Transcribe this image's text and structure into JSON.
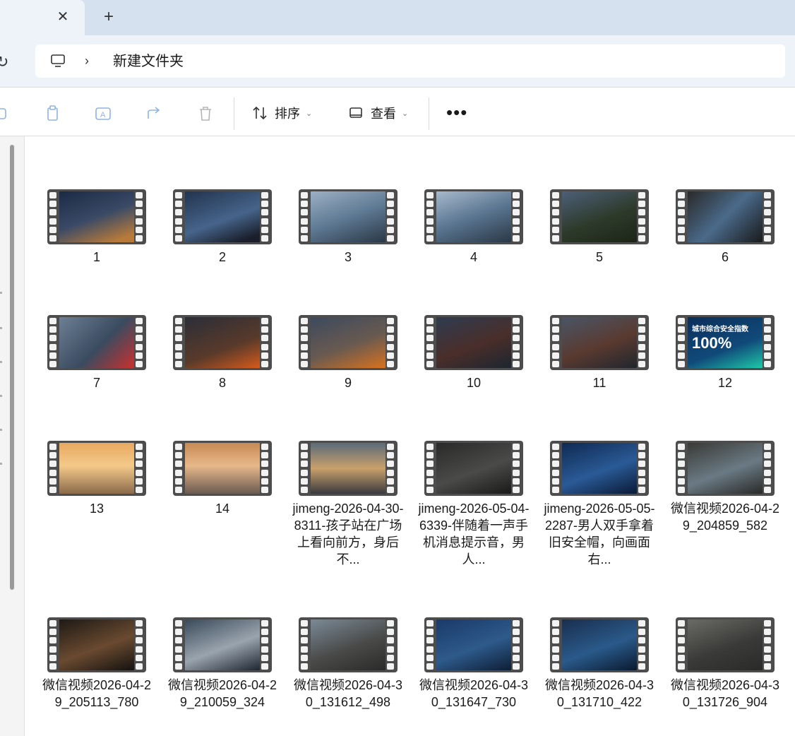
{
  "tabs": {
    "close_icon": "close-icon",
    "new_tab": "+"
  },
  "address": {
    "breadcrumb": "新建文件夹"
  },
  "toolbar": {
    "sort_label": "排序",
    "view_label": "查看",
    "more_label": "•••"
  },
  "colors": {
    "tab_strip": "#d6e1f0",
    "address_bar": "#eef3fa"
  },
  "files": [
    {
      "name": "1",
      "bg": "linear-gradient(160deg,#1b2a44,#3a4a66 50%,#b87a3a 90%)"
    },
    {
      "name": "2",
      "bg": "linear-gradient(160deg,#22344f,#46648a 55%,#1a1f2b 90%)"
    },
    {
      "name": "3",
      "bg": "linear-gradient(160deg,#9bb0c4,#5f7a94 50%,#2a3846)"
    },
    {
      "name": "4",
      "bg": "linear-gradient(160deg,#a6b9cc,#5a7590 50%,#2a3846)"
    },
    {
      "name": "5",
      "bg": "linear-gradient(160deg,#4d5f78,#2d3a2a 55%,#1c2418)"
    },
    {
      "name": "6",
      "bg": "linear-gradient(135deg,#2a2a2a,#4a6a8a 50%,#1a1a1a)"
    },
    {
      "name": "7",
      "bg": "linear-gradient(135deg,#6d7f94,#3a4b60 55%,#b33 95%)"
    },
    {
      "name": "8",
      "bg": "linear-gradient(160deg,#2a2e38,#5a3a2a 60%,#d65a1c)"
    },
    {
      "name": "9",
      "bg": "linear-gradient(160deg,#3b4a5e,#6a5a50 55%,#d8721e)"
    },
    {
      "name": "10",
      "bg": "linear-gradient(160deg,#2e3c50,#4a2e2a 55%,#1d2630)"
    },
    {
      "name": "11",
      "bg": "linear-gradient(160deg,#4a5566,#5a3a30 55%,#20262e)"
    },
    {
      "name": "12",
      "bg": "linear-gradient(160deg,#0c2f5a,#104a7a 60%,#1ec8a8)",
      "overlay_title": "城市综合安全指数",
      "overlay_big": "100%"
    },
    {
      "name": "13",
      "bg": "linear-gradient(180deg,#e7a860,#f4c98a 45%,#8a6a4a)"
    },
    {
      "name": "14",
      "bg": "linear-gradient(180deg,#c88a54,#e7b88a 45%,#6a5a50)"
    },
    {
      "name": "jimeng-2026-04-30-8311-孩子站在广场上看向前方，身后不...",
      "bg": "linear-gradient(180deg,#5a6a7a,#c9a06a 50%,#3a3a40)"
    },
    {
      "name": "jimeng-2026-05-04-6339-伴随着一声手机消息提示音，男人...",
      "bg": "linear-gradient(160deg,#2a2a2a,#4a4a48 55%,#1a1a1a)"
    },
    {
      "name": "jimeng-2026-05-05-2287-男人双手拿着旧安全帽，向画面右...",
      "bg": "linear-gradient(160deg,#0f2a52,#2a5a96 55%,#0a1a36)"
    },
    {
      "name": "微信视频2026-04-29_204859_582",
      "bg": "linear-gradient(160deg,#3a3a36,#6a7a84 55%,#2a2a28)"
    },
    {
      "name": "微信视频2026-04-29_205113_780",
      "bg": "linear-gradient(160deg,#1e1a16,#6a4a30 55%,#141210)"
    },
    {
      "name": "微信视频2026-04-29_210059_324",
      "bg": "linear-gradient(160deg,#3a4a5a,#9aa4ae 55%,#1e2630)"
    },
    {
      "name": "微信视频2026-04-30_131612_498",
      "bg": "linear-gradient(160deg,#7a8a98,#4a4a48 55%,#2a2a2a)"
    },
    {
      "name": "微信视频2026-04-30_131647_730",
      "bg": "linear-gradient(160deg,#1a3a6a,#2e5a8a 55%,#0e1e36)"
    },
    {
      "name": "微信视频2026-04-30_131710_422",
      "bg": "linear-gradient(160deg,#1a2e4e,#2a5a8a 55%,#0a1a30)"
    },
    {
      "name": "微信视频2026-04-30_131726_904",
      "bg": "linear-gradient(160deg,#6a6a66,#3a3a38 55%,#2a2a28)"
    }
  ]
}
